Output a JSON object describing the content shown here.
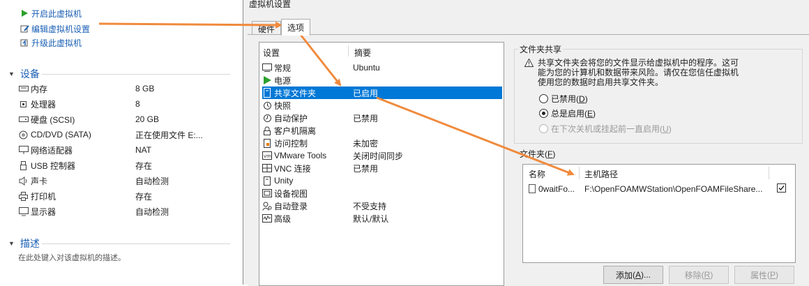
{
  "vm_commands": [
    {
      "label": "开启此虚拟机",
      "icon": "play-icon"
    },
    {
      "label": "编辑虚拟机设置",
      "icon": "edit-settings-icon"
    },
    {
      "label": "升级此虚拟机",
      "icon": "upgrade-icon"
    }
  ],
  "devices_section": {
    "title": "设备",
    "items": [
      {
        "name": "内存",
        "value": "8 GB",
        "icon": "memory-icon"
      },
      {
        "name": "处理器",
        "value": "8",
        "icon": "cpu-icon"
      },
      {
        "name": "硬盘 (SCSI)",
        "value": "20 GB",
        "icon": "harddisk-icon"
      },
      {
        "name": "CD/DVD (SATA)",
        "value": "正在使用文件 E:...",
        "icon": "cdrom-icon"
      },
      {
        "name": "网络适配器",
        "value": "NAT",
        "icon": "network-icon"
      },
      {
        "name": "USB 控制器",
        "value": "存在",
        "icon": "usb-icon"
      },
      {
        "name": "声卡",
        "value": "自动检测",
        "icon": "sound-icon"
      },
      {
        "name": "打印机",
        "value": "存在",
        "icon": "printer-icon"
      },
      {
        "name": "显示器",
        "value": "自动检测",
        "icon": "display-icon"
      }
    ]
  },
  "description_section": {
    "title": "描述",
    "placeholder": "在此处键入对该虚拟机的描述。"
  },
  "dialog": {
    "title": "虚拟机设置",
    "tabs": [
      {
        "label": "硬件",
        "active": false
      },
      {
        "label": "选项",
        "active": true
      }
    ],
    "settings_list": {
      "col_setting": "设置",
      "col_summary": "摘要",
      "items": [
        {
          "name": "常规",
          "summary": "Ubuntu",
          "icon": "general-icon",
          "selected": false
        },
        {
          "name": "电源",
          "summary": "",
          "icon": "power-icon",
          "selected": false
        },
        {
          "name": "共享文件夹",
          "summary": "已启用",
          "icon": "shared-folder-icon",
          "selected": true
        },
        {
          "name": "快照",
          "summary": "",
          "icon": "snapshot-icon",
          "selected": false
        },
        {
          "name": "自动保护",
          "summary": "已禁用",
          "icon": "autoprotect-icon",
          "selected": false
        },
        {
          "name": "客户机隔离",
          "summary": "",
          "icon": "lock-icon",
          "selected": false
        },
        {
          "name": "访问控制",
          "summary": "未加密",
          "icon": "access-control-icon",
          "selected": false
        },
        {
          "name": "VMware Tools",
          "summary": "关闭时间同步",
          "icon": "vmware-tools-icon",
          "selected": false
        },
        {
          "name": "VNC 连接",
          "summary": "已禁用",
          "icon": "vnc-icon",
          "selected": false
        },
        {
          "name": "Unity",
          "summary": "",
          "icon": "unity-icon",
          "selected": false
        },
        {
          "name": "设备视图",
          "summary": "",
          "icon": "device-view-icon",
          "selected": false
        },
        {
          "name": "自动登录",
          "summary": "不受支持",
          "icon": "autologin-icon",
          "selected": false
        },
        {
          "name": "高级",
          "summary": "默认/默认",
          "icon": "advanced-icon",
          "selected": false
        }
      ]
    },
    "folder_sharing": {
      "title": "文件夹共享",
      "warning": "共享文件夹会将您的文件显示给虚拟机中的程序。这可能为您的计算机和数据带来风险。请仅在您信任虚拟机使用您的数据时启用共享文件夹。",
      "options": [
        {
          "label": "已禁用",
          "key": "D",
          "checked": false,
          "disabled": false
        },
        {
          "label": "总是启用",
          "key": "E",
          "checked": true,
          "disabled": false
        },
        {
          "label": "在下次关机或挂起前一直启用",
          "key": "U",
          "checked": false,
          "disabled": true
        }
      ]
    },
    "folders": {
      "title": "文件夹",
      "key": "F",
      "col_name": "名称",
      "col_host_path": "主机路径",
      "rows": [
        {
          "name": "0waitFo...",
          "host_path": "F:\\OpenFOAMWStation\\OpenFOAMFileShare...",
          "enabled": true
        }
      ]
    },
    "buttons": {
      "add": {
        "label": "添加",
        "key": "A",
        "suffix": "..."
      },
      "remove": {
        "label": "移除",
        "key": "R"
      },
      "properties": {
        "label": "属性",
        "key": "P"
      }
    }
  },
  "annotation_colors": {
    "arrow": "#f08a3c",
    "selection": "#0078d7",
    "link": "#1a5fb4"
  }
}
